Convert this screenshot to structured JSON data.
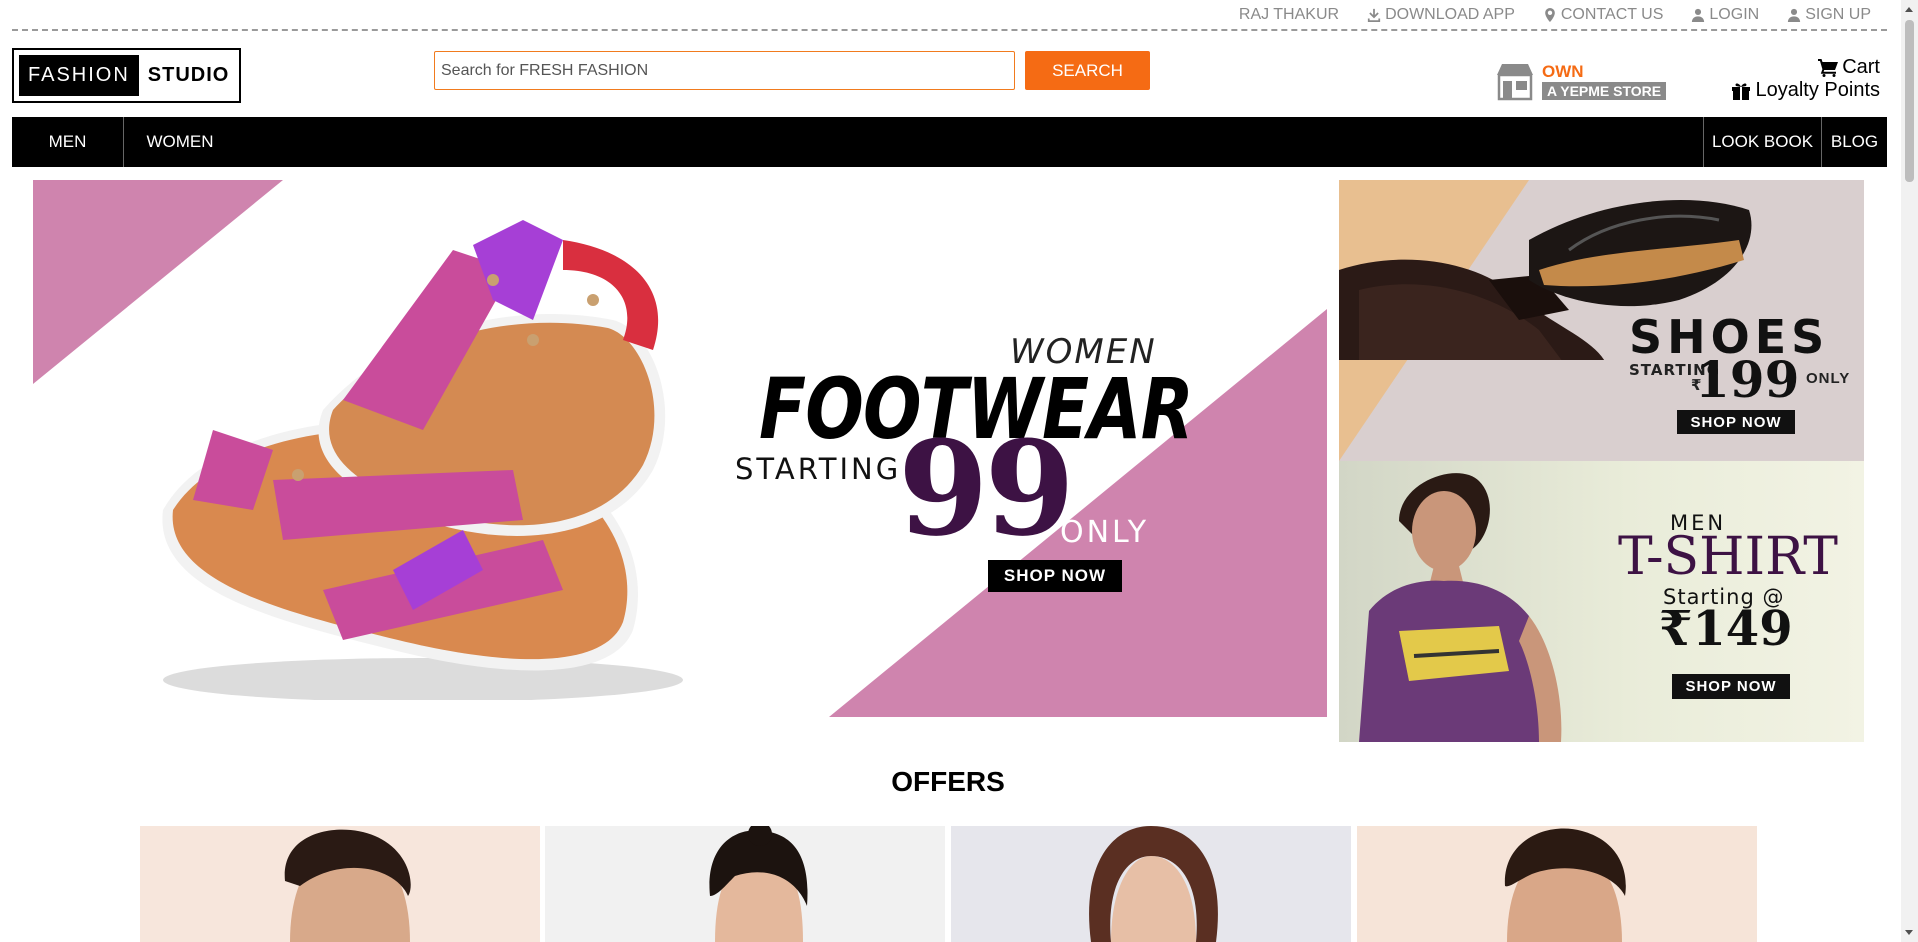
{
  "top_links": {
    "user": "RAJ THAKUR",
    "download": "DOWNLOAD APP",
    "contact": "CONTACT US",
    "login": "LOGIN",
    "signup": "SIGN UP"
  },
  "logo": {
    "left": "FASHION",
    "right": "STUDIO"
  },
  "search": {
    "placeholder": "Search for FRESH FASHION",
    "button": "SEARCH"
  },
  "own_store": {
    "top": "OWN",
    "bottom": "A YEPME STORE"
  },
  "cart": {
    "label": "Cart"
  },
  "loyalty": {
    "label": "Loyalty Points"
  },
  "nav": {
    "men": "MEN",
    "women": "WOMEN",
    "lookbook": "LOOK BOOK",
    "blog": "BLOG"
  },
  "main_banner": {
    "kicker": "WOMEN",
    "title": "FOOTWEAR",
    "starting": "STARTING ₹",
    "price": "99",
    "only": "ONLY",
    "cta": "SHOP NOW"
  },
  "side_banner_shoes": {
    "title": "SHOES",
    "starting": "STARTING",
    "currency": "₹",
    "price": "199",
    "only": "ONLY",
    "cta": "SHOP NOW"
  },
  "side_banner_tshirt": {
    "kicker": "MEN",
    "title": "T-SHIRT",
    "starting": "Starting @",
    "price": "₹149",
    "cta": "SHOP NOW"
  },
  "offers": {
    "title": "OFFERS"
  },
  "colors": {
    "accent": "#f56b14",
    "banner_pink": "#cf84ae",
    "deep_purple": "#3d1244",
    "nav_bg": "#000000"
  }
}
